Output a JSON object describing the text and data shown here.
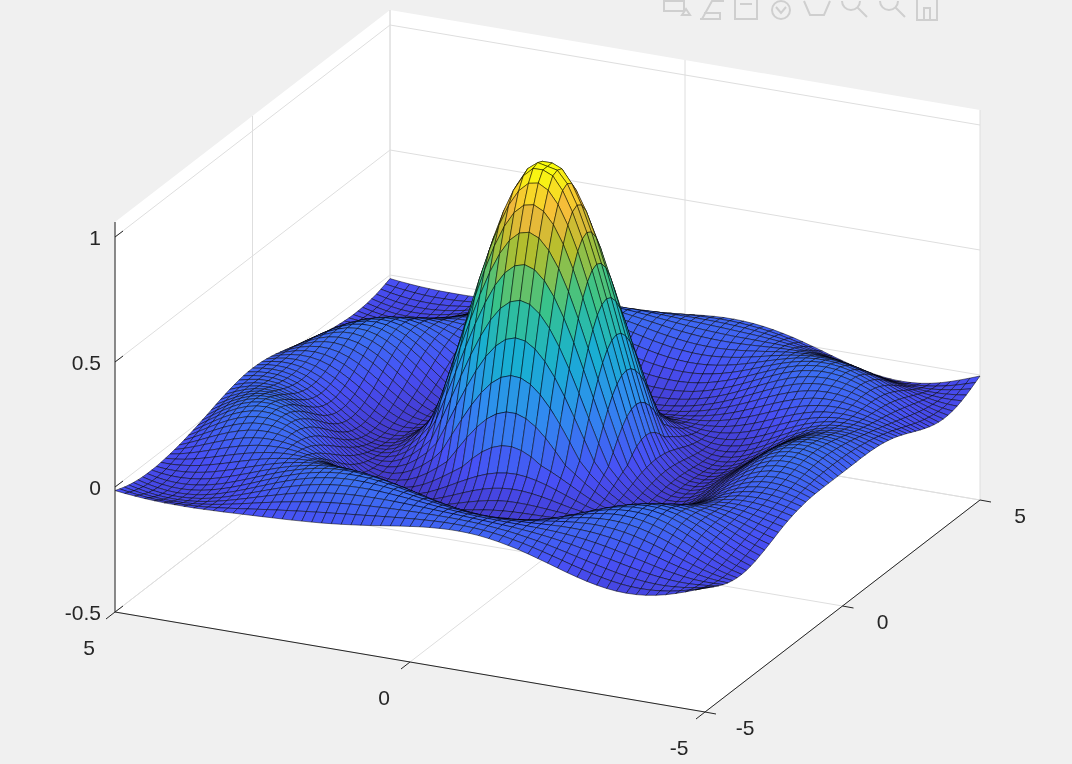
{
  "axes": {
    "z_tick_labels": [
      "1",
      "0.5",
      "0",
      "-0.5"
    ],
    "x_tick_labels": [
      "5",
      "0",
      "-5"
    ],
    "y_tick_labels": [
      "-5",
      "0",
      "5"
    ]
  }
}
